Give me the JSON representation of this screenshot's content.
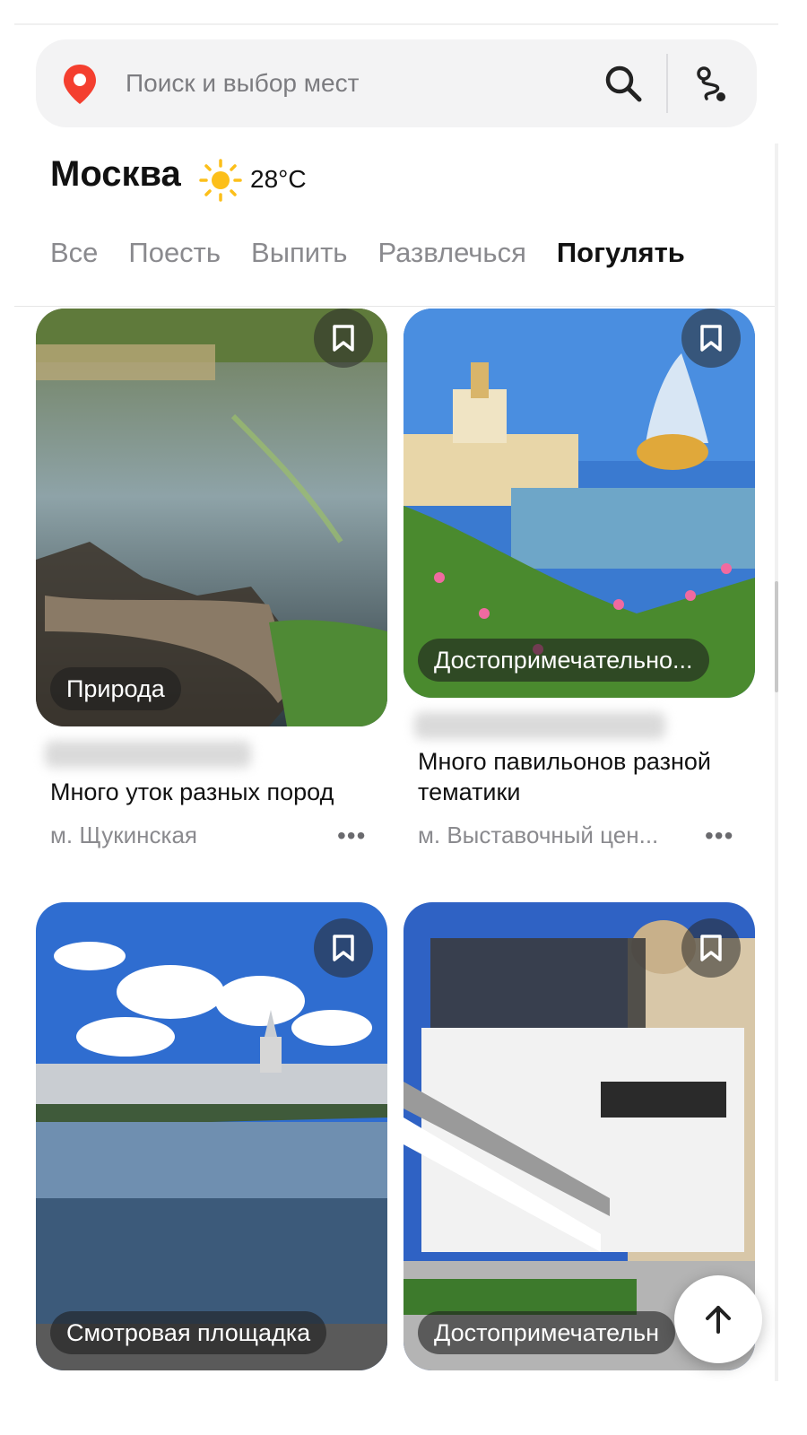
{
  "search": {
    "placeholder": "Поиск и выбор мест",
    "icons": [
      "map-pin-icon",
      "search-icon",
      "route-icon"
    ]
  },
  "header": {
    "city": "Москва",
    "weather_icon": "sun-icon",
    "temperature": "28°C"
  },
  "tabs": [
    {
      "label": "Все",
      "active": false
    },
    {
      "label": "Поесть",
      "active": false
    },
    {
      "label": "Выпить",
      "active": false
    },
    {
      "label": "Развлечься",
      "active": false
    },
    {
      "label": "Погулять",
      "active": true
    }
  ],
  "cards": [
    {
      "category": "Природа",
      "title": "Много уток разных пород",
      "metro": "м. Щукинская"
    },
    {
      "category": "Достопримечательно...",
      "title": "Много павильонов разной тематики",
      "metro": "м. Выставочный цен..."
    },
    {
      "category": "Смотровая площадка"
    },
    {
      "category": "Достопримечательн"
    }
  ],
  "more_label": "•••",
  "colors": {
    "accent_red": "#f43f2f",
    "chip_bg": "#1e1e1e",
    "tab_active": "#111111",
    "tab_inactive": "#8a8a8e"
  }
}
